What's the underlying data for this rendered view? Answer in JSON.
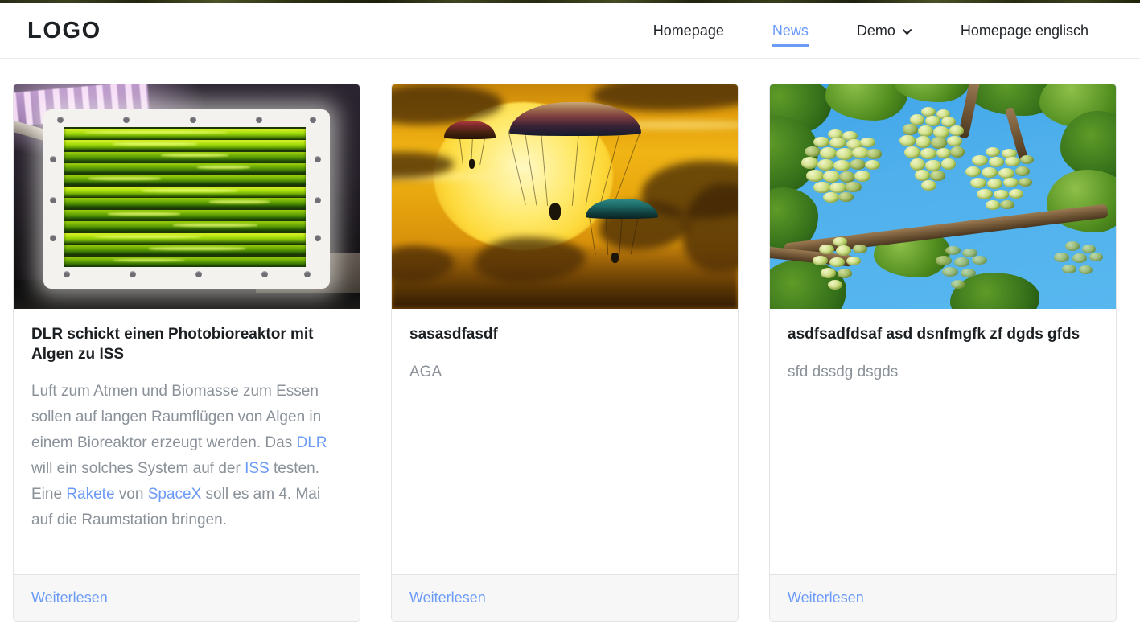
{
  "header": {
    "brand": "LOGO",
    "nav": [
      {
        "label": "Homepage",
        "active": false,
        "has_dropdown": false
      },
      {
        "label": "News",
        "active": true,
        "has_dropdown": false
      },
      {
        "label": "Demo",
        "active": false,
        "has_dropdown": true
      },
      {
        "label": "Homepage englisch",
        "active": false,
        "has_dropdown": false
      }
    ]
  },
  "cards": [
    {
      "image_name": "photobioreactor-with-algae-photo",
      "title": "DLR schickt einen Photobioreaktor mit Algen zu ISS",
      "text_parts": [
        {
          "t": "Luft zum Atmen und Biomasse zum Essen sollen auf langen Raumflügen von Algen in einem Bioreaktor erzeugt werden. Das ",
          "link": false
        },
        {
          "t": "DLR",
          "link": true
        },
        {
          "t": " will ein solches System auf der ",
          "link": false
        },
        {
          "t": "ISS",
          "link": true
        },
        {
          "t": " testen. Eine ",
          "link": false
        },
        {
          "t": "Rakete",
          "link": true
        },
        {
          "t": " von ",
          "link": false
        },
        {
          "t": "SpaceX",
          "link": true
        },
        {
          "t": " soll es am 4. Mai auf die Raumstation bringen.",
          "link": false
        }
      ],
      "read_more": "Weiterlesen"
    },
    {
      "image_name": "paragliders-at-sunset-photo",
      "title": "sasasdfasdf",
      "text_parts": [
        {
          "t": "AGA",
          "link": false
        }
      ],
      "read_more": "Weiterlesen"
    },
    {
      "image_name": "green-grapes-on-vine-photo",
      "title": "asdfsadfdsaf asd dsnfmgfk zf dgds gfds",
      "text_parts": [
        {
          "t": "sfd dssdg dsgds",
          "link": false
        }
      ],
      "read_more": "Weiterlesen"
    }
  ],
  "colors": {
    "link": "#6b9bf7",
    "muted_text": "#8a9199",
    "title_text": "#1b1f22",
    "card_border": "#e3e3e3",
    "footer_bg": "#f7f7f7"
  }
}
